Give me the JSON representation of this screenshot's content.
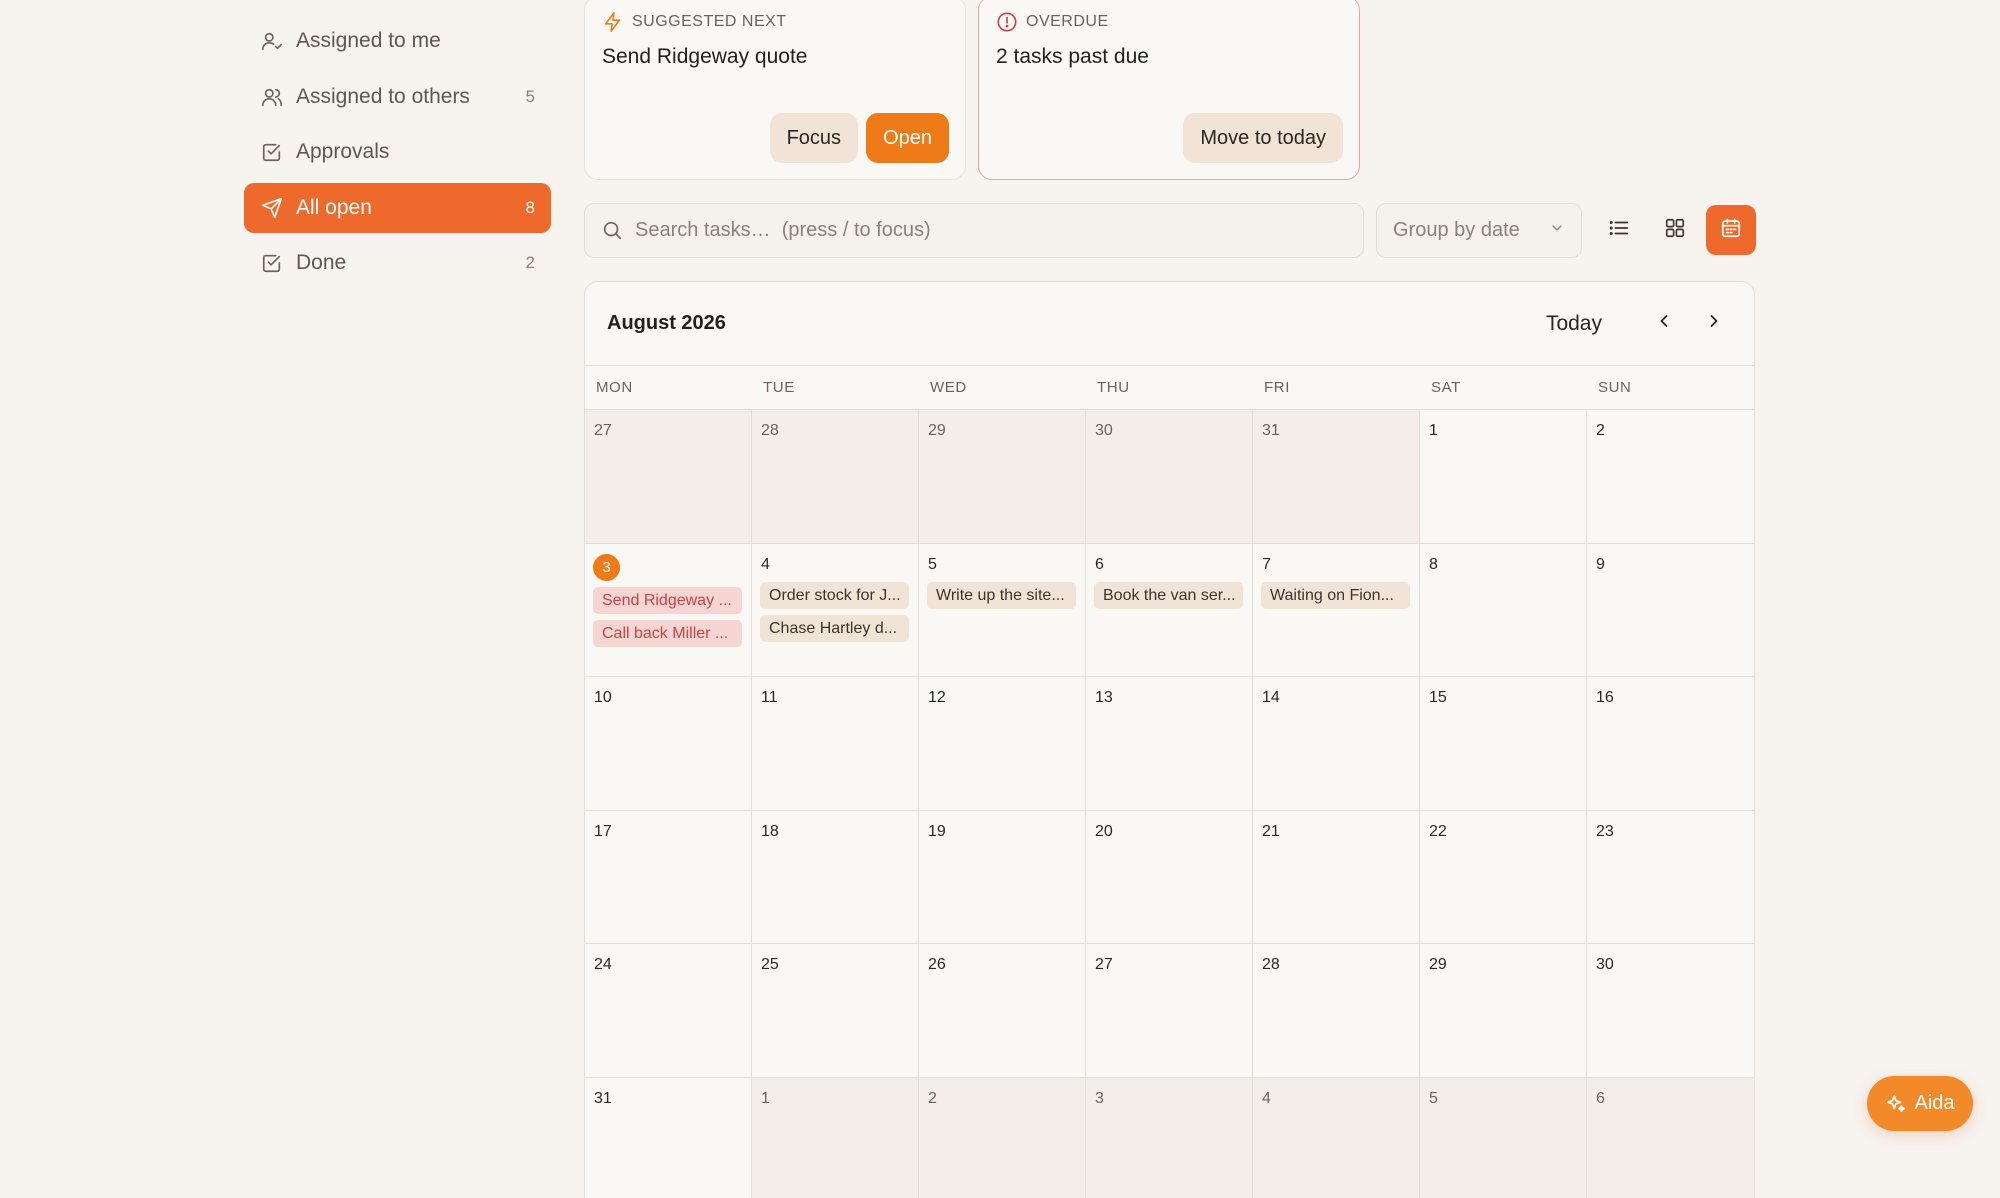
{
  "sidebar": {
    "items": [
      {
        "label": "Assigned to me",
        "count": "",
        "icon": "user-check-icon"
      },
      {
        "label": "Assigned to others",
        "count": "5",
        "icon": "users-icon"
      },
      {
        "label": "Approvals",
        "count": "",
        "icon": "checkbox-icon"
      },
      {
        "label": "All open",
        "count": "8",
        "icon": "send-icon",
        "active": true
      },
      {
        "label": "Done",
        "count": "2",
        "icon": "checkbox-icon"
      }
    ]
  },
  "suggested": {
    "kicker": "SUGGESTED NEXT",
    "title": "Send Ridgeway quote",
    "focus_label": "Focus",
    "open_label": "Open"
  },
  "overdue": {
    "kicker": "OVERDUE",
    "title": "2 tasks past due",
    "action_label": "Move to today"
  },
  "toolbar": {
    "search_placeholder": "Search tasks…  (press / to focus)",
    "group_by": "Group by date",
    "views": [
      "list-view",
      "grid-view",
      "calendar-view"
    ],
    "active_view": "calendar-view"
  },
  "calendar": {
    "month_label": "August 2026",
    "today_label": "Today",
    "weekdays": [
      "MON",
      "TUE",
      "WED",
      "THU",
      "FRI",
      "SAT",
      "SUN"
    ],
    "weeks": [
      [
        {
          "d": "27",
          "other": true
        },
        {
          "d": "28",
          "other": true
        },
        {
          "d": "29",
          "other": true
        },
        {
          "d": "30",
          "other": true
        },
        {
          "d": "31",
          "other": true
        },
        {
          "d": "1"
        },
        {
          "d": "2"
        }
      ],
      [
        {
          "d": "3",
          "today": true,
          "events": [
            {
              "t": "Send Ridgeway ...",
              "overdue": true
            },
            {
              "t": "Call back Miller ...",
              "overdue": true
            }
          ]
        },
        {
          "d": "4",
          "events": [
            {
              "t": "Order stock for J..."
            },
            {
              "t": "Chase Hartley d..."
            }
          ]
        },
        {
          "d": "5",
          "events": [
            {
              "t": "Write up the site..."
            }
          ]
        },
        {
          "d": "6",
          "events": [
            {
              "t": "Book the van ser..."
            }
          ]
        },
        {
          "d": "7",
          "events": [
            {
              "t": "Waiting on Fion..."
            }
          ]
        },
        {
          "d": "8"
        },
        {
          "d": "9"
        }
      ],
      [
        {
          "d": "10"
        },
        {
          "d": "11"
        },
        {
          "d": "12"
        },
        {
          "d": "13"
        },
        {
          "d": "14"
        },
        {
          "d": "15"
        },
        {
          "d": "16"
        }
      ],
      [
        {
          "d": "17"
        },
        {
          "d": "18"
        },
        {
          "d": "19"
        },
        {
          "d": "20"
        },
        {
          "d": "21"
        },
        {
          "d": "22"
        },
        {
          "d": "23"
        }
      ],
      [
        {
          "d": "24"
        },
        {
          "d": "25"
        },
        {
          "d": "26"
        },
        {
          "d": "27"
        },
        {
          "d": "28"
        },
        {
          "d": "29"
        },
        {
          "d": "30"
        }
      ],
      [
        {
          "d": "31"
        },
        {
          "d": "1",
          "other": true
        },
        {
          "d": "2",
          "other": true
        },
        {
          "d": "3",
          "other": true
        },
        {
          "d": "4",
          "other": true
        },
        {
          "d": "5",
          "other": true
        },
        {
          "d": "6",
          "other": true
        }
      ]
    ]
  },
  "assistant": {
    "label": "Aida",
    "icon": "sparkle-icon"
  },
  "colors": {
    "accent": "#ee6a2c",
    "primary_button": "#ef7a18",
    "overdue_text": "#c84444",
    "overdue_bg": "#f6d5d3"
  }
}
